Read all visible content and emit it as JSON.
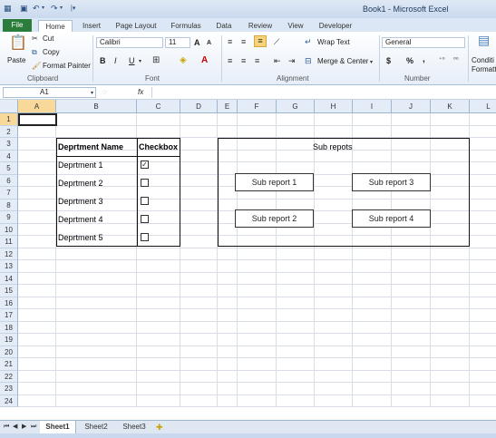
{
  "window": {
    "title": "Book1 - Microsoft Excel"
  },
  "tabs": {
    "file": "File",
    "items": [
      "Home",
      "Insert",
      "Page Layout",
      "Formulas",
      "Data",
      "Review",
      "View",
      "Developer"
    ],
    "active": "Home"
  },
  "ribbon": {
    "clipboard": {
      "paste": "Paste",
      "cut": "Cut",
      "copy": "Copy",
      "format_painter": "Format Painter",
      "label": "Clipboard"
    },
    "font": {
      "name": "Calibri",
      "size": "11",
      "bold": "B",
      "italic": "I",
      "underline": "U",
      "grow": "A",
      "shrink": "A",
      "label": "Font"
    },
    "alignment": {
      "wrap_text": "Wrap Text",
      "merge_center": "Merge & Center",
      "label": "Alignment"
    },
    "number": {
      "format": "General",
      "currency": "$",
      "percent": "%",
      "comma": ",",
      "label": "Number"
    },
    "styles": {
      "conditional": "Conditi",
      "formatting": "Formatti"
    }
  },
  "formula_bar": {
    "name_box": "A1",
    "fx": "fx",
    "value": ""
  },
  "columns": [
    "A",
    "B",
    "C",
    "D",
    "E",
    "F",
    "G",
    "H",
    "I",
    "J",
    "K",
    "L"
  ],
  "rows": [
    "1",
    "2",
    "3",
    "4",
    "5",
    "6",
    "7",
    "8",
    "9",
    "10",
    "11",
    "12",
    "13",
    "14",
    "15",
    "16",
    "17",
    "18",
    "19",
    "20",
    "21",
    "22",
    "23",
    "24"
  ],
  "table": {
    "headers": {
      "name": "Deprtment Name",
      "check": "Checkbox"
    },
    "rows": [
      {
        "name": "Deprtment 1",
        "checked": true
      },
      {
        "name": "Deprtment 2",
        "checked": false
      },
      {
        "name": "Deprtment 3",
        "checked": false
      },
      {
        "name": "Deprtment 4",
        "checked": false
      },
      {
        "name": "Deprtment 5",
        "checked": false
      }
    ]
  },
  "subreports": {
    "title": "Sub repots",
    "buttons": [
      "Sub report 1",
      "Sub report 3",
      "Sub report 2",
      "Sub report 4"
    ]
  },
  "sheets": {
    "items": [
      "Sheet1",
      "Sheet2",
      "Sheet3"
    ],
    "active": "Sheet1"
  }
}
